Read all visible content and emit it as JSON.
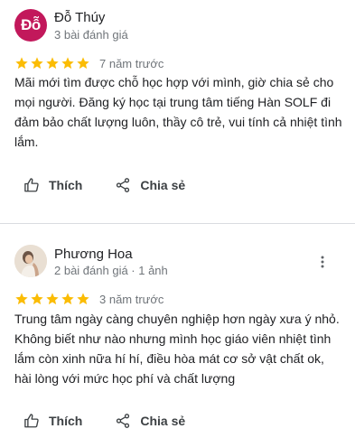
{
  "reviews": [
    {
      "avatar_letter": "Đỗ",
      "name": "Đỗ Thúy",
      "meta": "3 bài đánh giá",
      "rating": 5,
      "time": "7 năm trước",
      "text": "Mãi mới tìm được chỗ học hợp với mình, giờ chia sẻ cho mọi người. Đăng ký học tại trung tâm tiếng Hàn SOLF đi đảm bảo chất lượng luôn, thầy cô trẻ, vui tính cả nhiệt tình lắm."
    },
    {
      "avatar_letter": "",
      "name": "Phương Hoa",
      "meta": "2 bài đánh giá · 1 ảnh",
      "rating": 5,
      "time": "3 năm trước",
      "text": "Trung tâm ngày càng chuyên nghiệp hơn ngày xưa ý nhỏ. Không biết như nào nhưng mình học giáo viên nhiệt tình lắm còn xinh nữa hí hí, điều hòa mát cơ sở vật chất ok, hài lòng với mức học phí và chất lượng"
    }
  ],
  "actions": {
    "like_label": "Thích",
    "share_label": "Chia sẻ"
  },
  "colors": {
    "star": "#fbbc04",
    "avatar_bg": "#c2185b",
    "text_secondary": "#70757a",
    "divider": "#dadce0"
  },
  "icons": {
    "like": "thumb-up-outline-icon",
    "share": "share-icon",
    "more": "more-vert-icon",
    "star": "star-icon"
  }
}
